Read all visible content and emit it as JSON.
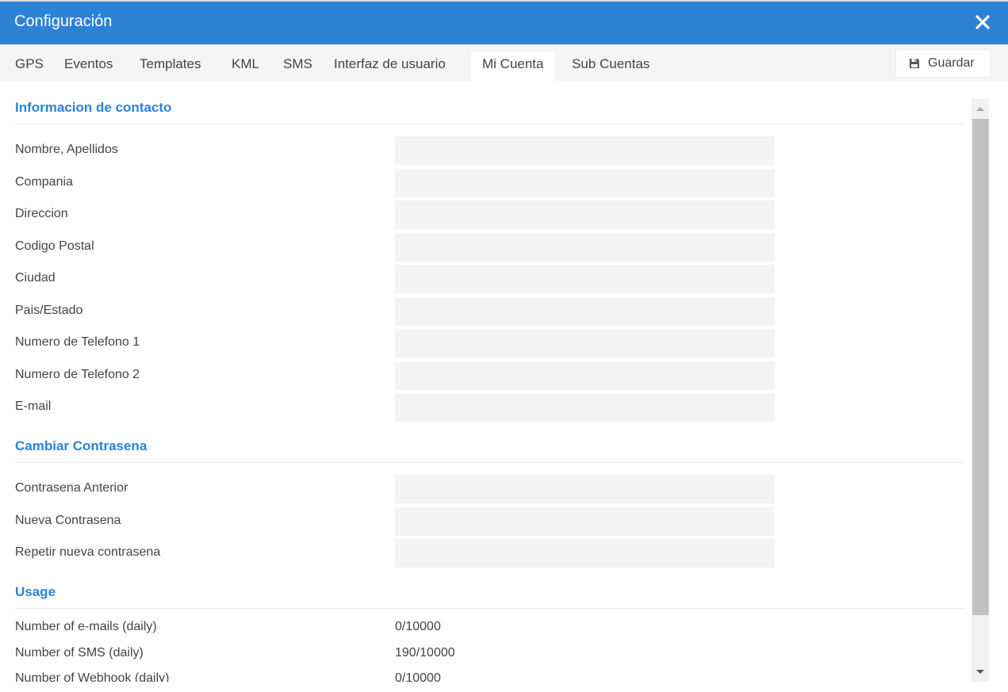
{
  "window": {
    "title": "Configuración"
  },
  "tabs": [
    {
      "label": "GPS"
    },
    {
      "label": "Eventos"
    },
    {
      "label": "Templates"
    },
    {
      "label": "KML"
    },
    {
      "label": "SMS"
    },
    {
      "label": "Interfaz de usuario"
    },
    {
      "label": "Mi Cuenta",
      "active": true
    },
    {
      "label": "Sub Cuentas"
    }
  ],
  "toolbar": {
    "save_label": "Guardar",
    "save_icon": "floppy-disk-icon"
  },
  "contact": {
    "title": "Informacion de contacto",
    "fields": [
      {
        "label": "Nombre, Apellidos",
        "value": ""
      },
      {
        "label": "Compania",
        "value": ""
      },
      {
        "label": "Direccion",
        "value": ""
      },
      {
        "label": "Codigo Postal",
        "value": ""
      },
      {
        "label": "Ciudad",
        "value": ""
      },
      {
        "label": "Pais/Estado",
        "value": ""
      },
      {
        "label": "Numero de Telefono 1",
        "value": ""
      },
      {
        "label": "Numero de Telefono 2",
        "value": ""
      },
      {
        "label": "E-mail",
        "value": ""
      }
    ]
  },
  "password": {
    "title": "Cambiar Contrasena",
    "fields": [
      {
        "label": "Contrasena Anterior",
        "value": ""
      },
      {
        "label": "Nueva Contrasena",
        "value": ""
      },
      {
        "label": "Repetir nueva contrasena",
        "value": ""
      }
    ]
  },
  "usage": {
    "title": "Usage",
    "rows": [
      {
        "label": "Number of e-mails (daily)",
        "value": "0/10000"
      },
      {
        "label": "Number of SMS (daily)",
        "value": "190/10000"
      },
      {
        "label": "Number of Webhook (daily)",
        "value": "0/10000"
      }
    ]
  },
  "colors": {
    "accent": "#2d82d6",
    "field_bg": "#f4f4f4",
    "tabbar_bg": "#f5f5f5"
  }
}
